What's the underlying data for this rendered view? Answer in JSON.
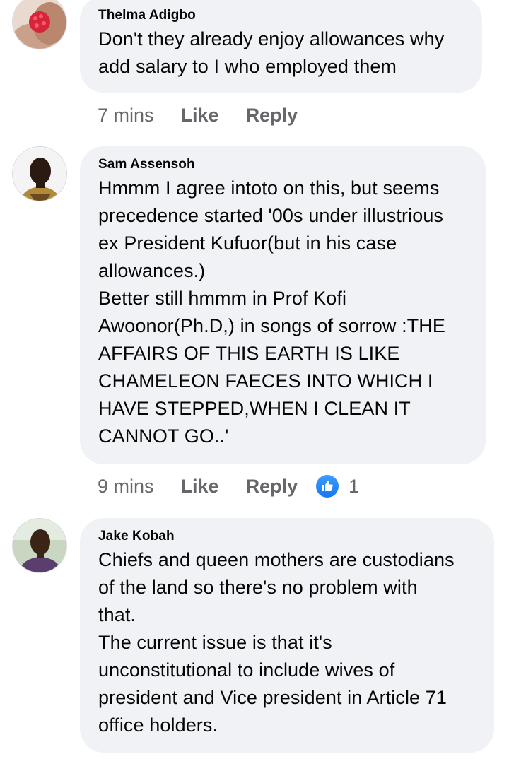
{
  "comments": [
    {
      "author": "Thelma Adigbo",
      "text": "Don't they already enjoy allowances why\nadd salary to I who employed them",
      "time": "7 mins",
      "like_label": "Like",
      "reply_label": "Reply",
      "avatar_icon": "raspberry-photo-avatar"
    },
    {
      "author": "Sam Assensoh",
      "text": "Hmmm I agree intoto on this, but seems\nprecedence started '00s under illustrious\nex President Kufuor(but in his case\nallowances.)\nBetter still hmmm in Prof Kofi\nAwoonor(Ph.D,) in songs of sorrow :THE\nAFFAIRS OF THIS EARTH IS LIKE\nCHAMELEON FAECES INTO WHICH I\nHAVE STEPPED,WHEN I CLEAN IT\nCANNOT GO..'",
      "time": "9 mins",
      "like_label": "Like",
      "reply_label": "Reply",
      "reaction_count": "1",
      "avatar_icon": "man-portrait-avatar"
    },
    {
      "author": "Jake Kobah",
      "text": "Chiefs and queen mothers are custodians\nof the land so there's no problem with\nthat.\nThe current issue is that it's\nunconstitutional to include wives of\npresident and Vice president in Article 71\noffice holders.",
      "avatar_icon": "young-man-portrait-avatar"
    }
  ],
  "colors": {
    "bubble": "#f0f2f5",
    "text": "#050505",
    "meta": "#65676b",
    "like_blue": "#1877f2"
  }
}
